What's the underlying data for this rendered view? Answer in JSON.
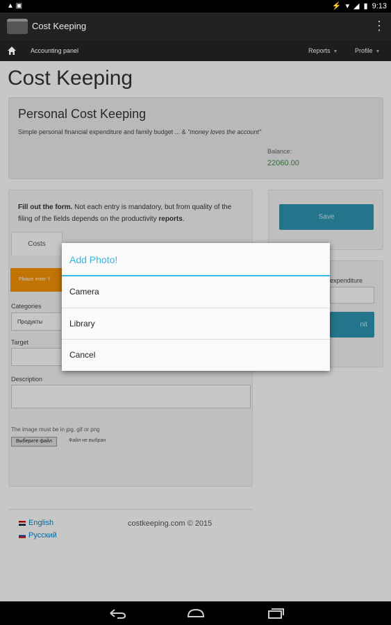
{
  "status_bar": {
    "time": "9:13"
  },
  "action_bar": {
    "title": "Cost Keeping"
  },
  "navbar": {
    "title": "Accounting panel",
    "reports": "Reports",
    "profile": "Profile"
  },
  "page": {
    "title": "Cost Keeping",
    "hero": {
      "heading": "Personal Cost Keeping",
      "text": "Simple personal financial expenditure and family budget ... & ",
      "quote": "\"money loves the account\"",
      "balance_label": "Balance:",
      "balance_value": "22060.00"
    },
    "form": {
      "intro_bold": "Fill out the form.",
      "intro_text": " Not each entry is mandatory, but from quality of the filing of the fields depends on the productivity ",
      "intro_bold2": "reports",
      "intro_end": ".",
      "tab_costs": "Costs",
      "warning": "Please enter Y",
      "categories_label": "Categories",
      "category_value": "Продукты",
      "target_label": "Target",
      "description_label": "Description",
      "file_hint": "The image must be in jpg, gif or png",
      "file_button": "Выберите файл",
      "file_status": "Файл не выбран"
    },
    "side": {
      "save_label": "Save",
      "expenditure_label": "expenditure",
      "submit_partial": "nit"
    },
    "footer": {
      "lang_en": "English",
      "lang_ru": "Русский",
      "copyright": "costkeeping.com © 2015"
    }
  },
  "dialog": {
    "title": "Add Photo!",
    "options": [
      "Camera",
      "Library",
      "Cancel"
    ]
  },
  "colors": {
    "accent": "#33b5e5",
    "button": "#2f96b4",
    "warning": "#f89406",
    "balance": "#468847"
  }
}
